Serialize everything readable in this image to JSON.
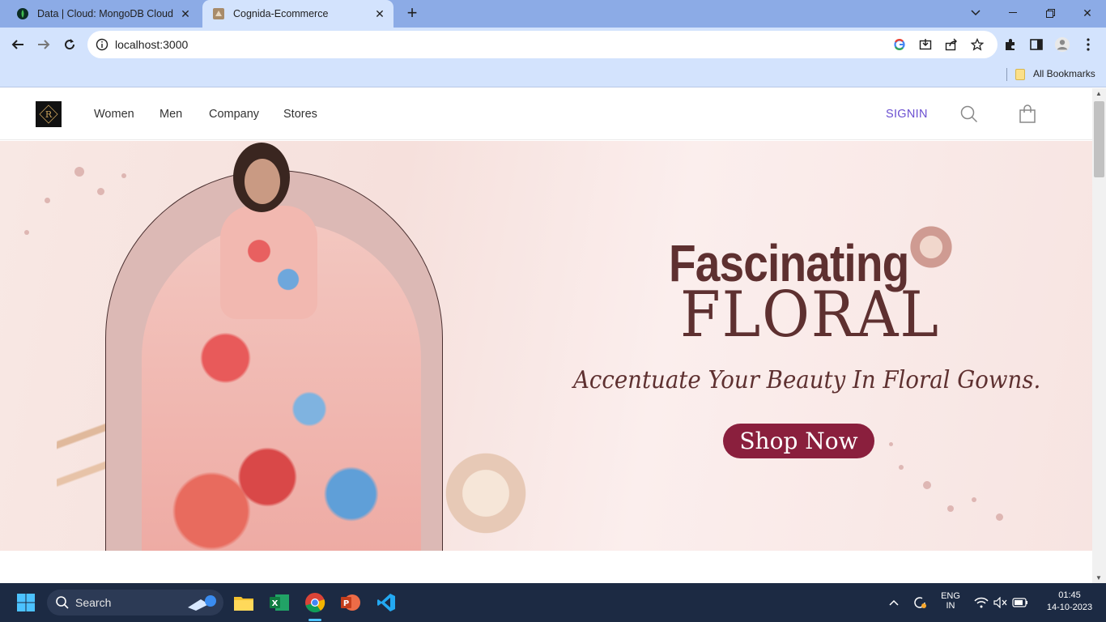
{
  "browser": {
    "tabs": [
      {
        "title": "Data | Cloud: MongoDB Cloud",
        "active": false,
        "icon": "mongodb-leaf-icon"
      },
      {
        "title": "Cognida-Ecommerce",
        "active": true,
        "icon": "site-favicon"
      }
    ],
    "address": "localhost:3000",
    "bookmarks_label": "All Bookmarks"
  },
  "site": {
    "nav": [
      "Women",
      "Men",
      "Company",
      "Stores"
    ],
    "signin_label": "SIGNIN",
    "logo_letter": "R"
  },
  "hero": {
    "title_line1": "Fascinating",
    "title_line2": "FLORAL",
    "subtitle": "Accentuate Your Beauty In Floral Gowns.",
    "cta_label": "Shop Now"
  },
  "taskbar": {
    "search_label": "Search",
    "lang_line1": "ENG",
    "lang_line2": "IN",
    "time": "01:45",
    "date": "14-10-2023"
  },
  "colors": {
    "accent_signin": "#6b4fd1",
    "hero_text": "#5e3030",
    "cta_bg": "#8a1f3d",
    "tabbar": "#8cabe6",
    "toolbar": "#d3e3fd"
  }
}
